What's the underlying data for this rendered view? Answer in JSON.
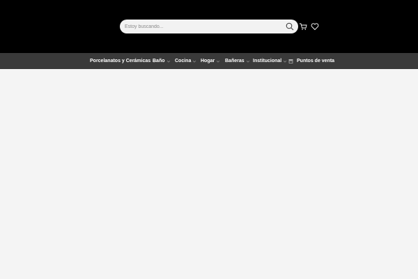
{
  "header": {
    "search": {
      "placeholder": "Estoy buscando...",
      "value": ""
    },
    "icons": [
      "search-icon",
      "cart-icon",
      "heart-icon"
    ]
  },
  "nav": {
    "items": [
      {
        "label": "Porcelanatos y Cerámicas",
        "has_dropdown": true
      },
      {
        "label": "Baño",
        "has_dropdown": true
      },
      {
        "label": "Cocina",
        "has_dropdown": true
      },
      {
        "label": "Hogar",
        "has_dropdown": true
      },
      {
        "label": "Bañeras",
        "has_dropdown": true
      },
      {
        "label": "Institucional",
        "has_dropdown": true
      },
      {
        "label": "Puntos de venta",
        "has_dropdown": false,
        "icon": "store-icon"
      }
    ]
  },
  "colors": {
    "header_bg": "#000000",
    "nav_bg": "#3a3a3a",
    "page_bg": "#f4f4f4",
    "search_bg": "#f2f2f2"
  }
}
